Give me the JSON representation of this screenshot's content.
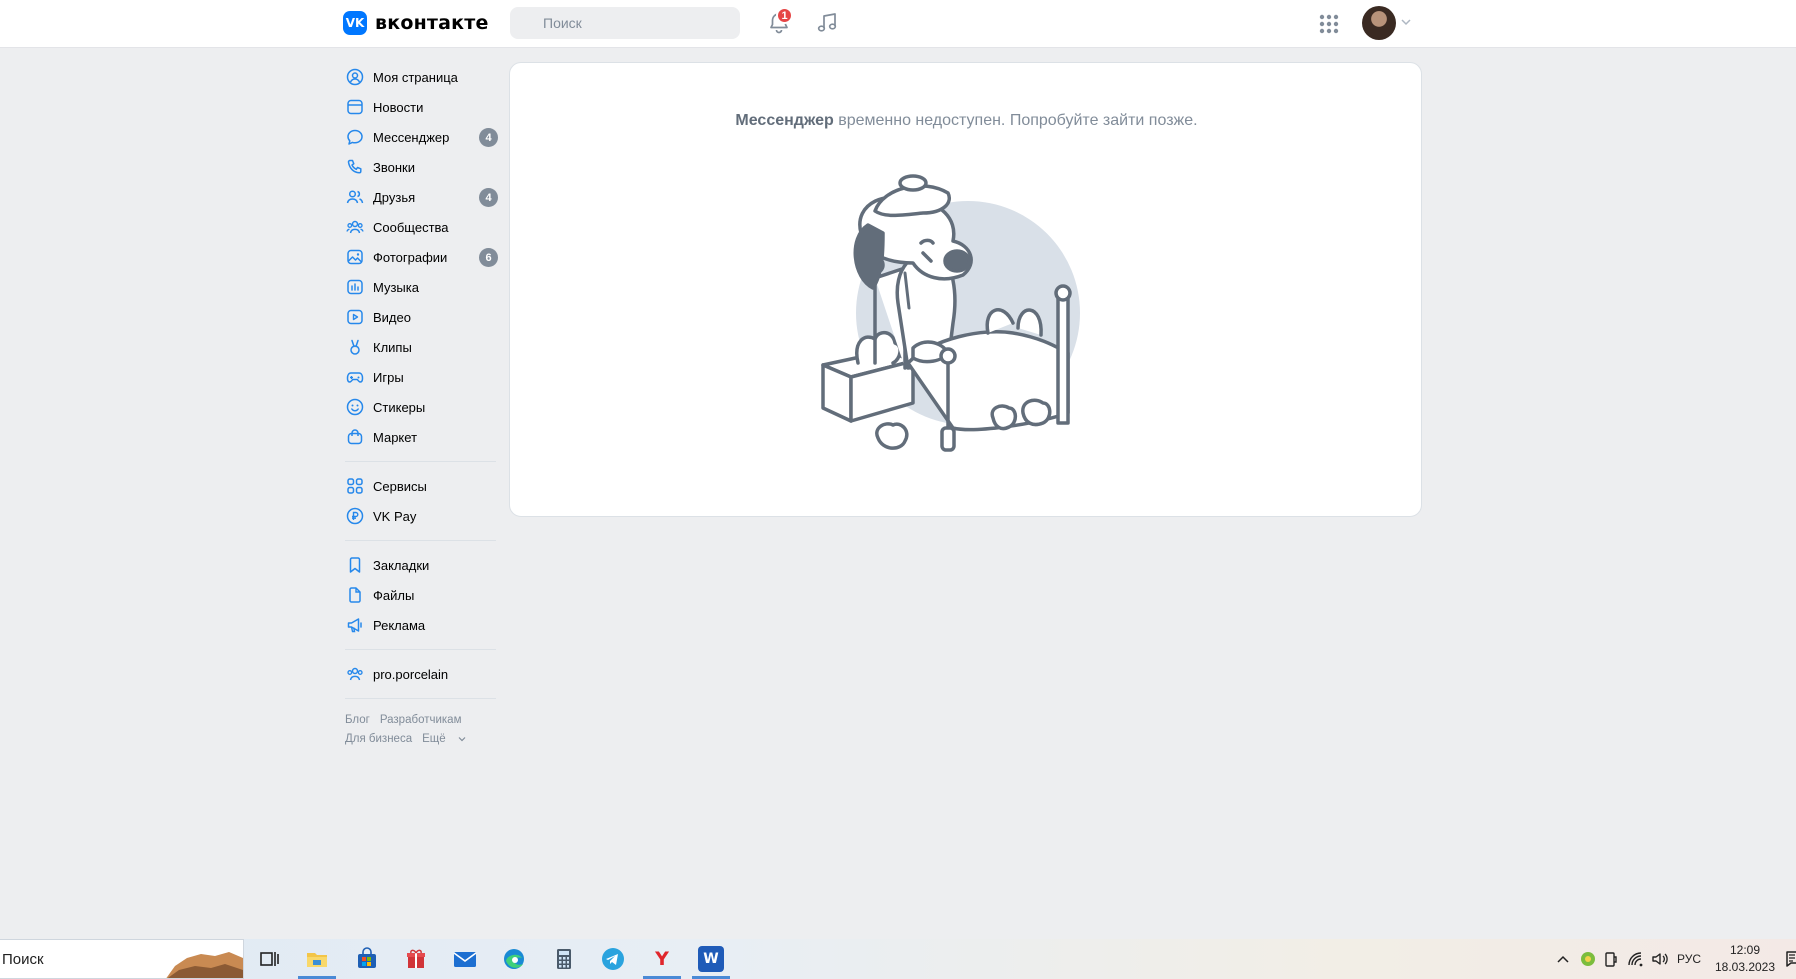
{
  "header": {
    "logo_text": "вконтакте",
    "logo_mark": "VK",
    "search_placeholder": "Поиск",
    "notifications_count": "1",
    "icons": {
      "search": "search-icon",
      "notifications": "bell-icon",
      "music": "music-note-icon",
      "apps": "grid-icon",
      "avatar_menu": "chevron-down-icon"
    }
  },
  "sidebar": {
    "items": [
      {
        "label": "Моя страница",
        "icon": "user-circle-icon",
        "badge": ""
      },
      {
        "label": "Новости",
        "icon": "newsfeed-icon",
        "badge": ""
      },
      {
        "label": "Мессенджер",
        "icon": "chat-bubble-icon",
        "badge": "4"
      },
      {
        "label": "Звонки",
        "icon": "phone-icon",
        "badge": ""
      },
      {
        "label": "Друзья",
        "icon": "users-icon",
        "badge": "4"
      },
      {
        "label": "Сообщества",
        "icon": "groups-icon",
        "badge": ""
      },
      {
        "label": "Фотографии",
        "icon": "photo-icon",
        "badge": "6"
      },
      {
        "label": "Музыка",
        "icon": "music-icon",
        "badge": ""
      },
      {
        "label": "Видео",
        "icon": "video-icon",
        "badge": ""
      },
      {
        "label": "Клипы",
        "icon": "clips-icon",
        "badge": ""
      },
      {
        "label": "Игры",
        "icon": "gamepad-icon",
        "badge": ""
      },
      {
        "label": "Стикеры",
        "icon": "smile-icon",
        "badge": ""
      },
      {
        "label": "Маркет",
        "icon": "bag-icon",
        "badge": ""
      }
    ],
    "items2": [
      {
        "label": "Сервисы",
        "icon": "services-icon"
      },
      {
        "label": "VK Pay",
        "icon": "vkpay-icon"
      }
    ],
    "items3": [
      {
        "label": "Закладки",
        "icon": "bookmark-icon"
      },
      {
        "label": "Файлы",
        "icon": "file-icon"
      },
      {
        "label": "Реклама",
        "icon": "megaphone-icon"
      }
    ],
    "items4": [
      {
        "label": "pro.porcelain",
        "icon": "groups-icon"
      }
    ],
    "footer": {
      "blog": "Блог",
      "developers": "Разработчикам",
      "business": "Для бизнеса",
      "more": "Ещё"
    }
  },
  "main": {
    "message_bold": "Мессенджер",
    "message_rest": " временно недоступен. Попробуйте зайти позже.",
    "illustration": "sick-dog-in-bed-illustration"
  },
  "taskbar": {
    "search_text": "Поиск",
    "apps": [
      "task-view-icon",
      "file-explorer-icon",
      "store-icon",
      "gift-icon",
      "mail-icon",
      "edge-icon",
      "calculator-icon",
      "telegram-icon",
      "yandex-browser-icon",
      "word-icon"
    ],
    "yandex_letter": "Y",
    "word_letter": "W",
    "language": "РУС",
    "time": "12:09",
    "date": "18.03.2023"
  },
  "colors": {
    "accent": "#0077ff",
    "badge_red": "#e64646",
    "badge_gray": "#818c99",
    "page_bg": "#edeef0"
  }
}
